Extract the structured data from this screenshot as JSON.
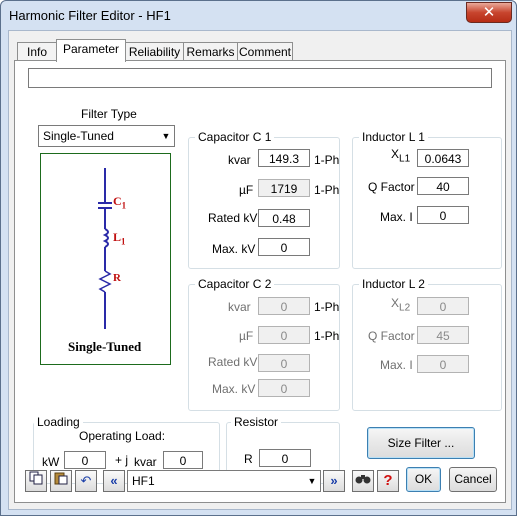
{
  "window": {
    "title": "Harmonic Filter Editor - HF1",
    "close_glyph": "✕"
  },
  "tabs": [
    "Info",
    "Parameter",
    "Reliability",
    "Remarks",
    "Comment"
  ],
  "description_value": "",
  "filter_type": {
    "label": "Filter Type",
    "value": "Single-Tuned",
    "diagram_label": "Single-Tuned",
    "c_label": "C",
    "c_sub": "1",
    "l_label": "L",
    "l_sub": "1",
    "r_label": "R"
  },
  "capacitor_c1": {
    "title": "Capacitor C 1",
    "kvar_label": "kvar",
    "kvar": "149.3",
    "kvar_unit": "1-Ph",
    "uf_label": "µF",
    "uf": "1719",
    "uf_unit": "1-Ph",
    "rated_kv_label": "Rated kV",
    "rated_kv": "0.48",
    "max_kv_label": "Max. kV",
    "max_kv": "0"
  },
  "inductor_l1": {
    "title": "Inductor L 1",
    "xl_label": "X",
    "xl_sub": "L1",
    "xl": "0.0643",
    "q_label": "Q Factor",
    "q": "40",
    "max_i_label": "Max. I",
    "max_i": "0"
  },
  "capacitor_c2": {
    "title": "Capacitor C 2",
    "kvar_label": "kvar",
    "kvar": "0",
    "kvar_unit": "1-Ph",
    "uf_label": "µF",
    "uf": "0",
    "uf_unit": "1-Ph",
    "rated_kv_label": "Rated kV",
    "rated_kv": "0",
    "max_kv_label": "Max. kV",
    "max_kv": "0"
  },
  "inductor_l2": {
    "title": "Inductor L 2",
    "xl_label": "X",
    "xl_sub": "L2",
    "xl": "0",
    "q_label": "Q Factor",
    "q": "45",
    "max_i_label": "Max. I",
    "max_i": "0"
  },
  "loading": {
    "title": "Loading",
    "op_label": "Operating Load:",
    "kw_label": "kW",
    "kw": "0",
    "j_label": "+ j",
    "kvar_label": "kvar",
    "kvar": "0"
  },
  "resistor": {
    "title": "Resistor",
    "r_label": "R",
    "r": "0"
  },
  "buttons": {
    "size_filter": "Size Filter ...",
    "ok": "OK",
    "cancel": "Cancel"
  },
  "navigator": {
    "selected": "HF1"
  },
  "toolbar_icons": [
    "copy-icon",
    "paste-icon",
    "undo-icon",
    "prev-icon",
    "next-icon",
    "find-icon",
    "help-icon"
  ]
}
